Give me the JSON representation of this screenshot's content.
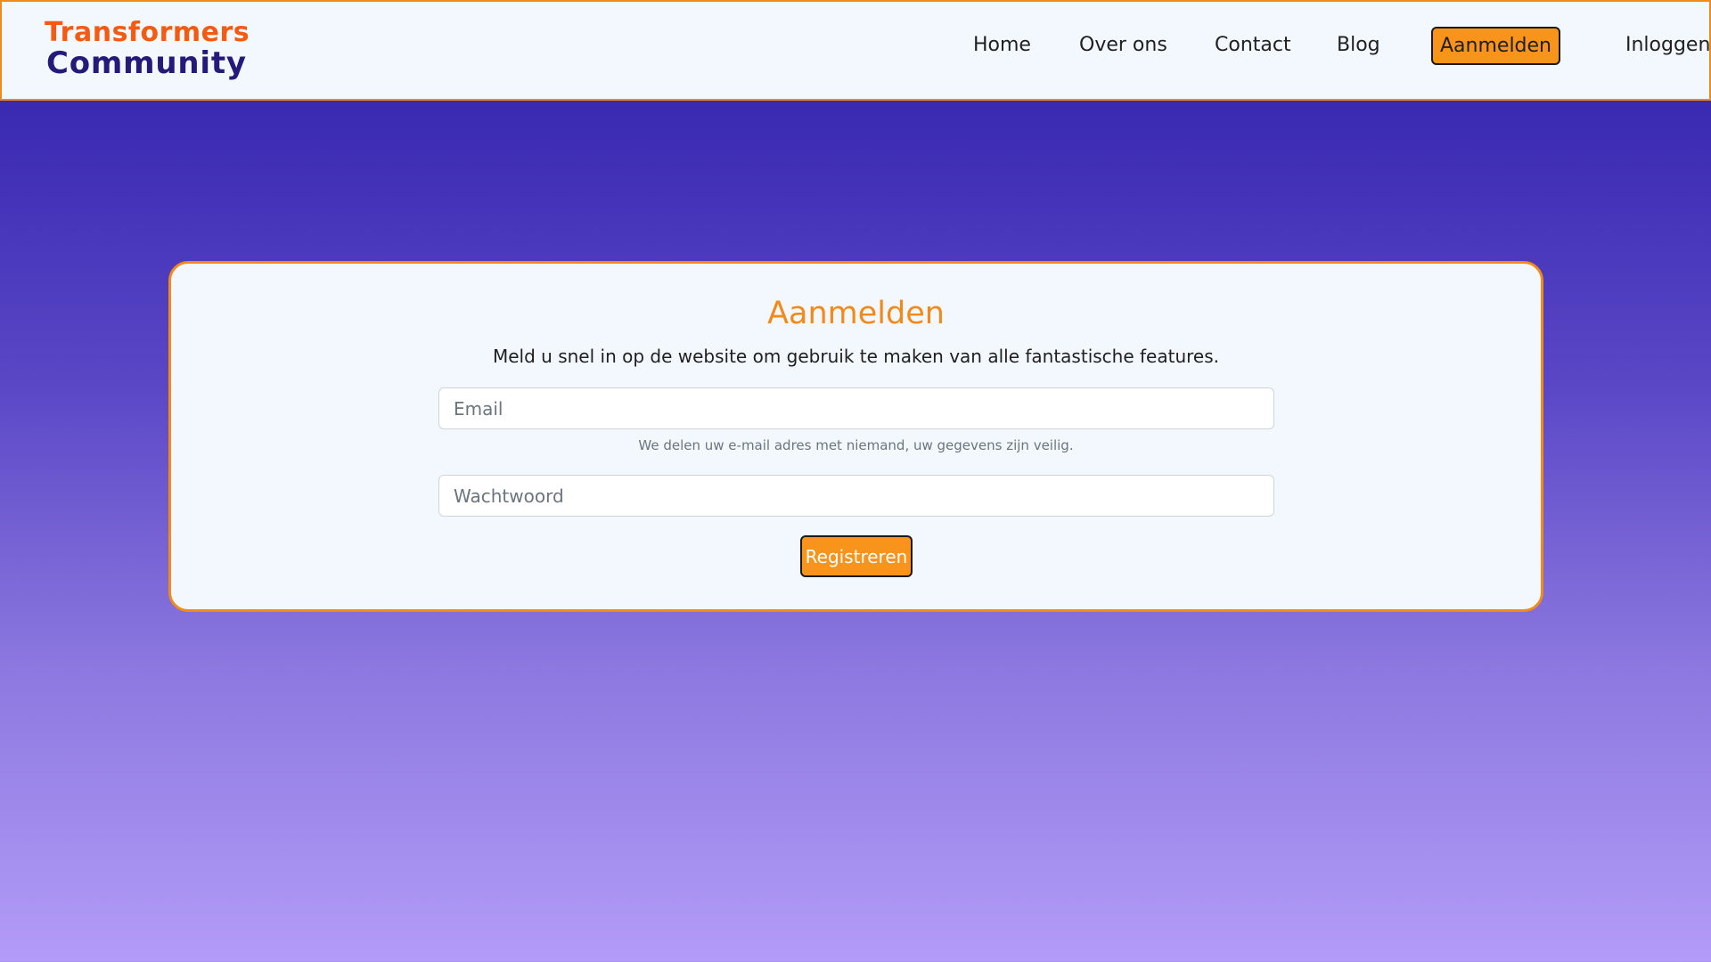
{
  "brand": {
    "line1": "Transformers",
    "line2": "Community",
    "colors": {
      "line1": "#f55a12",
      "line2": "#231a7a"
    }
  },
  "nav": {
    "items": [
      {
        "label": "Home"
      },
      {
        "label": "Over ons"
      },
      {
        "label": "Contact"
      },
      {
        "label": "Blog"
      },
      {
        "label": "Aanmelden",
        "active": true
      },
      {
        "label": "Inloggen"
      }
    ]
  },
  "form": {
    "title": "Aanmelden",
    "subtitle": "Meld u snel in op de website om gebruik te maken van alle fantastische features.",
    "email": {
      "value": "",
      "placeholder": "Email"
    },
    "email_help": "We delen uw e-mail adres met niemand, uw gegevens zijn veilig.",
    "password": {
      "value": "",
      "placeholder": "Wachtwoord"
    },
    "submit_label": "Registreren"
  },
  "theme": {
    "accent": "#f28a1a",
    "button": "#f8931c",
    "background_top": "#2e1fa6",
    "background_bottom": "#b39cf8",
    "card_background": "#f3f8ff"
  }
}
